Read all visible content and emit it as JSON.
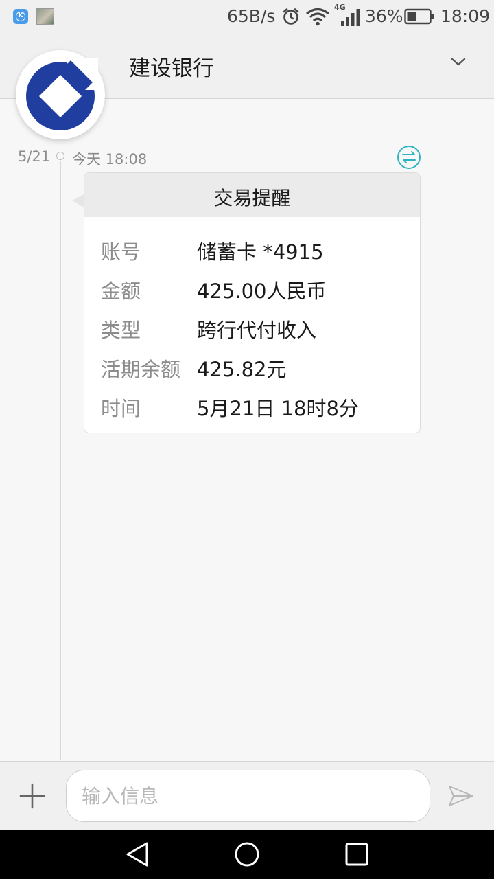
{
  "status_bar": {
    "net_speed": "65B/s",
    "network_type": "4G",
    "battery_percent": "36%",
    "time": "18:09"
  },
  "header": {
    "title": "建设银行"
  },
  "conversation": {
    "date": "5/21",
    "time_label": "今天 18:08"
  },
  "message_card": {
    "title": "交易提醒",
    "rows": [
      {
        "label": "账号",
        "value": "储蓄卡 *4915"
      },
      {
        "label": "金额",
        "value": "425.00人民币"
      },
      {
        "label": "类型",
        "value": "跨行代付收入"
      },
      {
        "label": "活期余额",
        "value": "425.82元"
      },
      {
        "label": "时间",
        "value": "5月21日 18时8分"
      }
    ]
  },
  "input_bar": {
    "placeholder": "输入信息"
  },
  "colors": {
    "bank_blue": "#1f3ea0",
    "accent_teal": "#2ab5c0"
  }
}
